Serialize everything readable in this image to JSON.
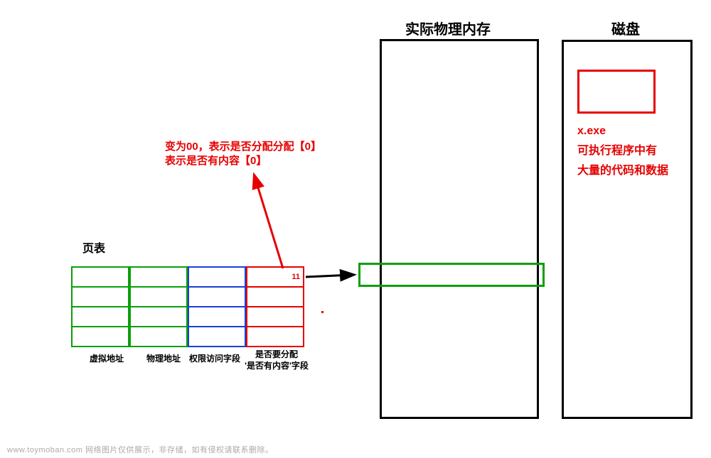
{
  "memory": {
    "title": "实际物理内存"
  },
  "disk": {
    "title": "磁盘",
    "file_label": "x.exe",
    "desc_line1": "可执行程序中有",
    "desc_line2": "大量的代码和数据"
  },
  "page_table": {
    "title": "页表",
    "flag_value": "11",
    "columns": {
      "virtual": "虚拟地址",
      "physical": "物理地址",
      "permission": "权限访问字段",
      "alloc": "是否要分配\n'是否有内容'字段"
    }
  },
  "annotation": {
    "line1": "变为00，表示是否分配分配【0】",
    "line2": "表示是否有内容【0】"
  },
  "watermark": "www.toymoban.com 网络图片仅供展示，非存储，如有侵权请联系删除。",
  "colors": {
    "red": "#e60000",
    "green": "#0a9f0a",
    "blue": "#1a3fd6",
    "black": "#000000"
  }
}
